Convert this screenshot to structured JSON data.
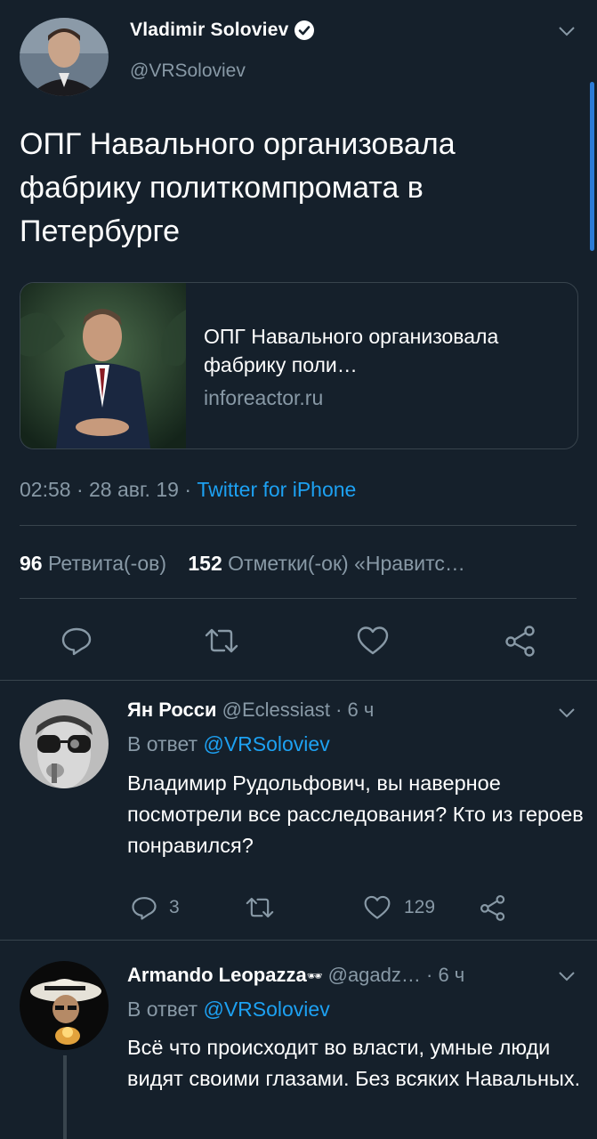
{
  "main_tweet": {
    "author_name": "Vladimir Soloviev",
    "handle": "@VRSoloviev",
    "text": "ОПГ Навального организовала фабрику политкомпромата в Петербурге",
    "card": {
      "title": "ОПГ Навального организовала фабрику поли…",
      "domain": "inforeactor.ru"
    },
    "time": "02:58 · 28 авг. 19 · ",
    "source": "Twitter for iPhone",
    "retweet_count": "96",
    "retweet_label": "Ретвита(-ов)",
    "like_count": "152",
    "like_label": "Отметки(-ок) «Нравитс…"
  },
  "replies": [
    {
      "author_name": "Ян Росси",
      "handle": "@Eclessiast",
      "time": " · 6 ч",
      "reply_prefix": "В ответ ",
      "reply_to": "@VRSoloviev",
      "text": "Владимир Рудольфович,  вы наверное посмотрели все расследования? Кто из героев понравился?",
      "reply_count": "3",
      "retweet_count": "",
      "like_count": "129"
    },
    {
      "author_name": "Armando Leopazza",
      "name_emoji": "🕶",
      "handle": "@agadz…",
      "time": " · 6 ч",
      "reply_prefix": "В ответ ",
      "reply_to": "@VRSoloviev",
      "text": "Всё что происходит во власти, умные люди видят своими глазами. Без всяких Навальных."
    }
  ],
  "colors": {
    "background": "#15202b",
    "accent": "#1da1f2",
    "secondary_text": "#8899a6",
    "divider": "#38444d"
  }
}
